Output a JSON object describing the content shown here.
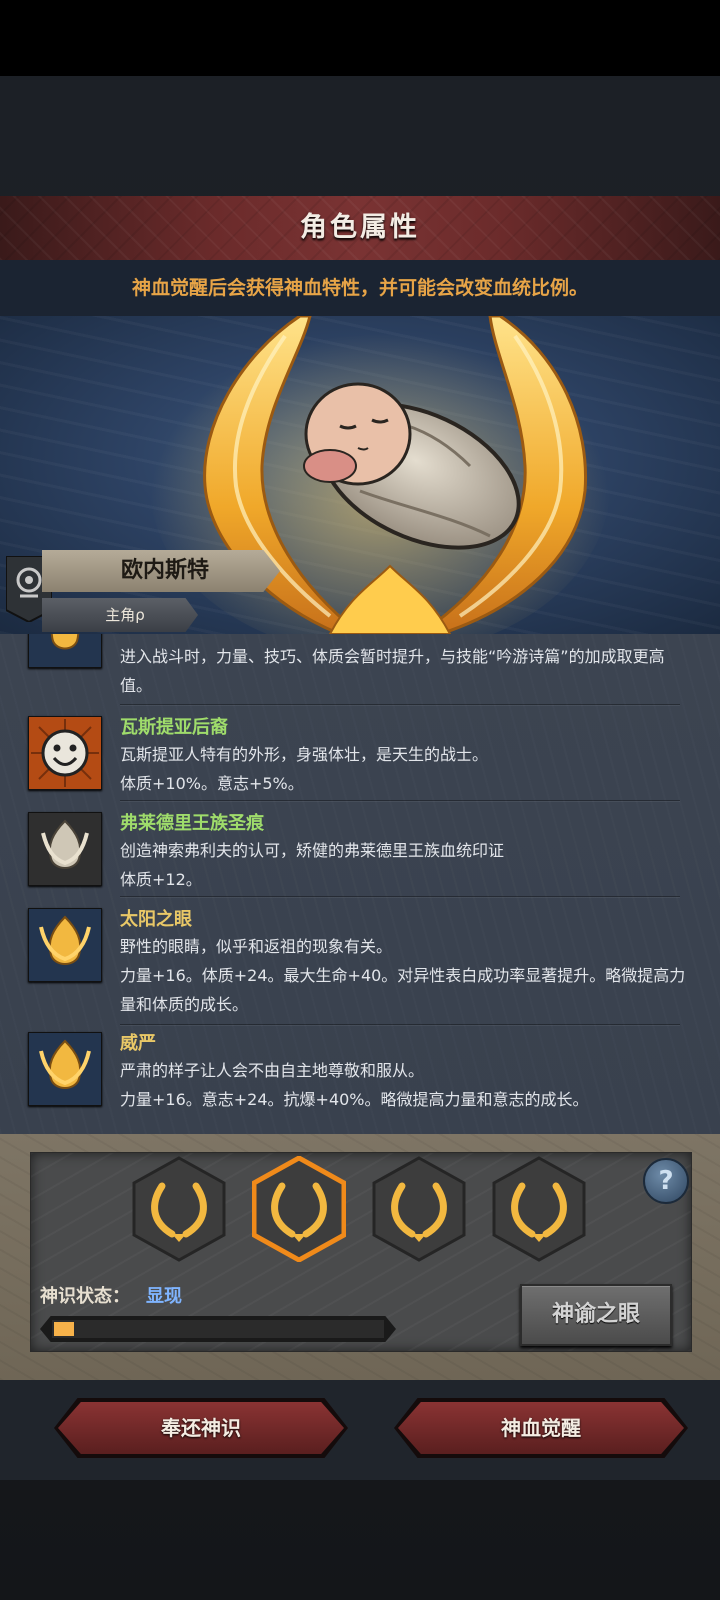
{
  "header": {
    "title": "角色属性",
    "subtitle": "神血觉醒后会获得神血特性，并可能会改变血统比例。"
  },
  "character": {
    "name": "欧内斯特",
    "role": "主角ρ"
  },
  "traits": [
    {
      "name": "",
      "desc": "进入战斗时，力量、技巧、体质会暂时提升，与技能“吟游诗篇”的加成取更高值。",
      "icon": "golden-crest-icon"
    },
    {
      "name": "瓦斯提亚后裔",
      "name_color": "#9fdc6b",
      "desc": "瓦斯提亚人特有的外形，身强体壮，是天生的战士。",
      "effect": "体质+10%。意志+5%。",
      "icon": "smiley-face-icon"
    },
    {
      "name": "弗莱德里王族圣痕",
      "name_color": "#9fdc6b",
      "desc": "创造神索弗利夫的认可，矫健的弗莱德里王族血统印证",
      "effect": "体质+12。",
      "icon": "silver-crest-icon"
    },
    {
      "name": "太阳之眼",
      "name_color": "#e9c867",
      "desc": "野性的眼睛，似乎和返祖的现象有关。",
      "effect": "力量+16。体质+24。最大生命+40。对异性表白成功率显著提升。略微提高力量和体质的成长。",
      "icon": "golden-crest-icon"
    },
    {
      "name": "威严",
      "name_color": "#e9c867",
      "desc": "严肃的样子让人会不由自主地尊敬和服从。",
      "effect": "力量+16。意志+24。抗爆+40%。略微提高力量和意志的成长。",
      "icon": "golden-crest-icon"
    }
  ],
  "awakening": {
    "status_label": "神识状态：",
    "status_value": "显现",
    "progress": 0.06,
    "oracle_button": "神谕之眼",
    "help": "?",
    "slots": 4,
    "selected_slot": 1
  },
  "actions": {
    "return_button": "奉还神识",
    "awaken_button": "神血觉醒"
  },
  "colors": {
    "accent_orange": "#e7a447",
    "trait_green": "#9fdc6b",
    "trait_gold": "#e9c867",
    "status_blue": "#7fb4ff"
  }
}
